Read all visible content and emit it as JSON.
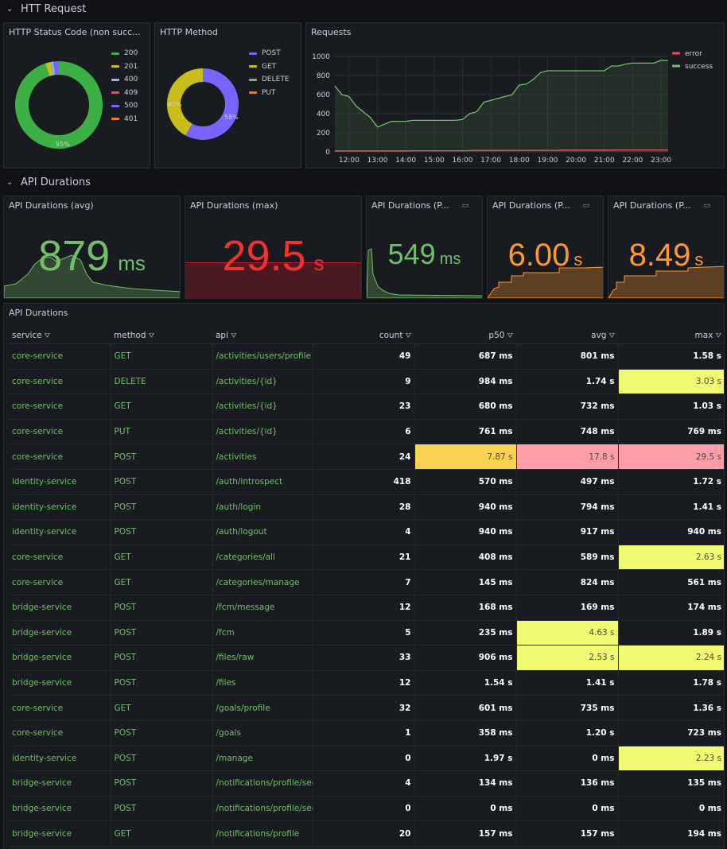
{
  "rows": {
    "http": "HTT Request",
    "durations": "API Durations"
  },
  "status_panel": {
    "title": "HTTP Status Code (non succ...",
    "center_label": "95%",
    "chart_data": {
      "type": "pie",
      "labels": [
        "200",
        "201",
        "400",
        "409",
        "500",
        "401"
      ],
      "values": [
        95,
        2,
        1,
        0,
        2,
        0
      ],
      "colors": [
        "#3cb044",
        "#c8bd1b",
        "#8ab8ff",
        "#f2495c",
        "#7a63ff",
        "#ff780a"
      ],
      "legend_position": "right"
    }
  },
  "method_panel": {
    "title": "HTTP Method",
    "label_a": "42%",
    "label_b": "58%",
    "chart_data": {
      "type": "pie",
      "labels": [
        "POST",
        "GET",
        "DELETE",
        "PUT"
      ],
      "values": [
        58,
        42,
        0,
        0
      ],
      "colors": [
        "#7a63ff",
        "#c8bd1b",
        "#73bf69",
        "#ff780a"
      ],
      "legend_position": "right"
    }
  },
  "requests_panel": {
    "title": "Requests",
    "chart_data": {
      "type": "line",
      "x": [
        "11:30",
        "11:45",
        "12:00",
        "12:15",
        "12:30",
        "12:45",
        "13:00",
        "13:15",
        "13:30",
        "13:45",
        "14:00",
        "14:15",
        "14:30",
        "14:45",
        "15:00",
        "15:15",
        "15:30",
        "15:45",
        "16:00",
        "16:15",
        "16:30",
        "16:45",
        "17:00",
        "17:15",
        "17:30",
        "17:45",
        "18:00",
        "18:15",
        "18:30",
        "18:45",
        "19:00",
        "19:15",
        "19:30",
        "19:45",
        "20:00",
        "20:15",
        "20:30",
        "20:45",
        "21:00",
        "21:15",
        "21:30",
        "21:45",
        "22:00",
        "22:15",
        "22:30",
        "22:45",
        "23:00",
        "23:15"
      ],
      "xticks": [
        "12:00",
        "13:00",
        "14:00",
        "15:00",
        "16:00",
        "17:00",
        "18:00",
        "19:00",
        "20:00",
        "21:00",
        "22:00",
        "23:00"
      ],
      "yticks": [
        "0",
        "200",
        "400",
        "600",
        "800",
        "1000"
      ],
      "ylim": [
        0,
        1000
      ],
      "series": [
        {
          "name": "error",
          "color": "#f2495c",
          "values": [
            10,
            10,
            10,
            10,
            10,
            10,
            10,
            10,
            10,
            10,
            10,
            12,
            12,
            12,
            12,
            12,
            12,
            12,
            12,
            13,
            15,
            15,
            15,
            15,
            15,
            16,
            16,
            16,
            16,
            16,
            16,
            16,
            18,
            18,
            18,
            18,
            18,
            18,
            18,
            18,
            20,
            20,
            20,
            20,
            20,
            20,
            20,
            20
          ]
        },
        {
          "name": "success",
          "color": "#73bf69",
          "values": [
            690,
            600,
            580,
            480,
            420,
            360,
            260,
            290,
            320,
            320,
            320,
            330,
            330,
            330,
            330,
            330,
            330,
            330,
            340,
            400,
            420,
            520,
            540,
            560,
            580,
            600,
            700,
            710,
            760,
            830,
            850,
            850,
            850,
            850,
            850,
            850,
            850,
            850,
            850,
            900,
            900,
            920,
            930,
            930,
            930,
            930,
            960,
            955
          ]
        }
      ],
      "legend_position": "top-right",
      "grid": true
    }
  },
  "stats": [
    {
      "title": "API Durations (avg)",
      "value": "879",
      "unit": "ms",
      "color": "#73bf69"
    },
    {
      "title": "API Durations (max)",
      "value": "29.5",
      "unit": "s",
      "color": "#f2312e"
    },
    {
      "title": "API Durations (P...",
      "value": "549",
      "unit": "ms",
      "color": "#73bf69"
    },
    {
      "title": "API Durations (P...",
      "value": "6.00",
      "unit": "s",
      "color": "#ff9830"
    },
    {
      "title": "API Durations (P...",
      "value": "8.49",
      "unit": "s",
      "color": "#ff9830"
    }
  ],
  "table": {
    "title": "API Durations",
    "columns": [
      "service",
      "method",
      "api",
      "count",
      "p50",
      "avg",
      "max"
    ],
    "rows": [
      [
        "core-service",
        "GET",
        "/activities/users/profile",
        "49",
        "687 ms",
        "801 ms",
        "1.58 s"
      ],
      [
        "core-service",
        "DELETE",
        "/activities/{id}",
        "9",
        "984 ms",
        "1.74 s",
        "3.03 s"
      ],
      [
        "core-service",
        "GET",
        "/activities/{id}",
        "23",
        "680 ms",
        "732 ms",
        "1.03 s"
      ],
      [
        "core-service",
        "PUT",
        "/activities/{id}",
        "6",
        "761 ms",
        "748 ms",
        "769 ms"
      ],
      [
        "core-service",
        "POST",
        "/activities",
        "24",
        "7.87 s",
        "17.8 s",
        "29.5 s"
      ],
      [
        "identity-service",
        "POST",
        "/auth/introspect",
        "418",
        "570 ms",
        "497 ms",
        "1.72 s"
      ],
      [
        "identity-service",
        "POST",
        "/auth/login",
        "28",
        "940 ms",
        "794 ms",
        "1.41 s"
      ],
      [
        "identity-service",
        "POST",
        "/auth/logout",
        "4",
        "940 ms",
        "917 ms",
        "940 ms"
      ],
      [
        "core-service",
        "GET",
        "/categories/all",
        "21",
        "408 ms",
        "589 ms",
        "2.63 s"
      ],
      [
        "core-service",
        "GET",
        "/categories/manage",
        "7",
        "145 ms",
        "824 ms",
        "561 ms"
      ],
      [
        "bridge-service",
        "POST",
        "/fcm/message",
        "12",
        "168 ms",
        "169 ms",
        "174 ms"
      ],
      [
        "bridge-service",
        "POST",
        "/fcm",
        "5",
        "235 ms",
        "4.63 s",
        "1.89 s"
      ],
      [
        "bridge-service",
        "POST",
        "/files/raw",
        "33",
        "906 ms",
        "2.53 s",
        "2.24 s"
      ],
      [
        "bridge-service",
        "POST",
        "/files",
        "12",
        "1.54 s",
        "1.41 s",
        "1.78 s"
      ],
      [
        "core-service",
        "GET",
        "/goals/profile",
        "32",
        "601 ms",
        "735 ms",
        "1.36 s"
      ],
      [
        "core-service",
        "POST",
        "/goals",
        "1",
        "358 ms",
        "1.20 s",
        "723 ms"
      ],
      [
        "identity-service",
        "POST",
        "/manage",
        "0",
        "1.97 s",
        "0 ms",
        "2.23 s"
      ],
      [
        "bridge-service",
        "POST",
        "/notifications/profile/seen",
        "4",
        "134 ms",
        "136 ms",
        "135 ms"
      ],
      [
        "bridge-service",
        "POST",
        "/notifications/profile/seen",
        "0",
        "0 ms",
        "0 ms",
        "0 ms"
      ],
      [
        "bridge-service",
        "GET",
        "/notifications/profile",
        "20",
        "157 ms",
        "157 ms",
        "194 ms"
      ]
    ],
    "highlights": {
      "1": {
        "6": "y"
      },
      "4": {
        "4": "o",
        "5": "r",
        "6": "r"
      },
      "8": {
        "6": "y"
      },
      "11": {
        "5": "y"
      },
      "12": {
        "5": "y",
        "6": "y"
      },
      "16": {
        "6": "y"
      }
    }
  }
}
